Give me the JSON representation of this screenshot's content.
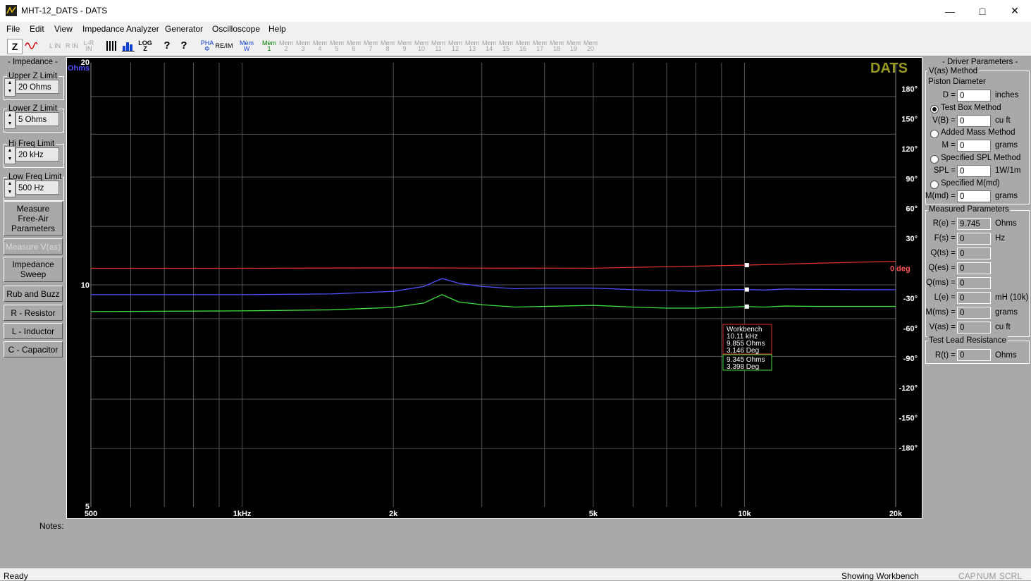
{
  "window": {
    "title": "MHT-12_DATS - DATS"
  },
  "menu": [
    "File",
    "Edit",
    "View",
    "Impedance Analyzer",
    "Generator",
    "Oscilloscope",
    "Help"
  ],
  "toolbar": {
    "buttons": [
      "Z",
      "~",
      "L IN",
      "R IN",
      "L-R IN",
      "",
      "",
      "LOG Z",
      "?",
      "?",
      "PHA Φ",
      "RE/IM",
      "Mem W"
    ],
    "mem_slots": [
      "1",
      "2",
      "3",
      "4",
      "5",
      "6",
      "7",
      "8",
      "9",
      "10",
      "11",
      "12",
      "13",
      "14",
      "15",
      "16",
      "17",
      "18",
      "19",
      "20"
    ]
  },
  "left": {
    "group_title": "- Impedance -",
    "upper_label": "Upper Z Limit",
    "upper_value": "20 Ohms",
    "lower_label": "Lower Z Limit",
    "lower_value": "5 Ohms",
    "hifreq_label": "Hi Freq Limit",
    "hifreq_value": "20 kHz",
    "lowfreq_label": "Low Freq Limit",
    "lowfreq_value": "500 Hz",
    "measure_free_air": [
      "Measure",
      "Free-Air",
      "Parameters"
    ],
    "measure_vas": "Measure V(as)",
    "impedance_sweep": [
      "Impedance",
      "Sweep"
    ],
    "rub_buzz": "Rub and Buzz",
    "r_resistor": "R - Resistor",
    "l_inductor": "L - Inductor",
    "c_capacitor": "C - Capacitor"
  },
  "plot": {
    "logo": "DATS",
    "y_unit": "Ohms",
    "y_ticks": [
      "20",
      "10",
      "5"
    ],
    "x_ticks": [
      "500",
      "1kHz",
      "2k",
      "5k",
      "10k",
      "20k"
    ],
    "phase_ticks": [
      "180°",
      "150°",
      "120°",
      "90°",
      "60°",
      "30°",
      "0 deg",
      "-30°",
      "-60°",
      "-90°",
      "-120°",
      "-150°",
      "-180°"
    ],
    "cursor_box1": [
      "Workbench",
      "10.11 kHz",
      "9.855 Ohms",
      "3.146 Deg"
    ],
    "cursor_box2": [
      "9.345 Ohms",
      "3.398 Deg"
    ],
    "colors": {
      "blue": "#5050ff",
      "green": "#40e040",
      "red": "#e03030",
      "logo": "#9a9a20",
      "grid": "#555555"
    }
  },
  "chart_data": {
    "type": "line",
    "title": "",
    "xlabel": "",
    "ylabel": "Ohms",
    "x_scale": "log",
    "y_scale": "log",
    "xlim": [
      500,
      20000
    ],
    "ylim": [
      5,
      20
    ],
    "y2lim": [
      -180,
      180
    ],
    "series": [
      {
        "x": [
          500,
          1000,
          1500,
          2000,
          2300,
          2500,
          2700,
          3000,
          3500,
          4000,
          5000,
          6000,
          7000,
          8000,
          9000,
          10000,
          11000,
          12000,
          14000,
          17000,
          20000
        ],
        "values": [
          9.7,
          9.7,
          9.72,
          9.8,
          9.95,
          10.2,
          10.05,
          9.95,
          9.88,
          9.9,
          9.9,
          9.85,
          9.82,
          9.8,
          9.85,
          9.855,
          9.84,
          9.87,
          9.86,
          9.85,
          9.85
        ]
      },
      {
        "x": [
          500,
          1000,
          1500,
          2000,
          2300,
          2500,
          2700,
          3000,
          3500,
          4000,
          5000,
          6000,
          7000,
          8000,
          9000,
          10000,
          11000,
          12000,
          14000,
          17000,
          20000
        ],
        "values": [
          9.2,
          9.22,
          9.25,
          9.32,
          9.45,
          9.7,
          9.48,
          9.4,
          9.33,
          9.35,
          9.38,
          9.33,
          9.3,
          9.3,
          9.32,
          9.345,
          9.33,
          9.36,
          9.35,
          9.35,
          9.35
        ]
      },
      {
        "x": [
          500,
          1000,
          2000,
          3000,
          5000,
          10000,
          15000,
          20000
        ],
        "values": [
          0,
          0,
          0.4,
          0.2,
          0.1,
          3.15,
          5.5,
          7.0
        ]
      }
    ]
  },
  "right": {
    "driver_title": "- Driver Parameters -",
    "vas_method": "V(as) Method",
    "piston_diameter": "Piston Diameter",
    "d_label": "D =",
    "d_value": "0",
    "d_unit": "inches",
    "test_box": "Test Box Method",
    "vb_label": "V(B) =",
    "vb_value": "0",
    "vb_unit": "cu ft",
    "added_mass": "Added Mass Method",
    "m_label": "M =",
    "m_value": "0",
    "m_unit": "grams",
    "spl_method": "Specified SPL Method",
    "spl_label": "SPL =",
    "spl_value": "0",
    "spl_unit": "1W/1m",
    "mmd_method": "Specified M(md)",
    "mmd_label": "M(md) =",
    "mmd_value": "0",
    "mmd_unit": "grams",
    "measured_title": "Measured Parameters",
    "params": [
      {
        "label": "R(e) =",
        "value": "9.745",
        "unit": "Ohms"
      },
      {
        "label": "F(s) =",
        "value": "0",
        "unit": "Hz"
      },
      {
        "label": "Q(ts) =",
        "value": "0",
        "unit": ""
      },
      {
        "label": "Q(es) =",
        "value": "0",
        "unit": ""
      },
      {
        "label": "Q(ms) =",
        "value": "0",
        "unit": ""
      },
      {
        "label": "L(e) =",
        "value": "0",
        "unit": "mH (10k)"
      },
      {
        "label": "M(ms) =",
        "value": "0",
        "unit": "grams"
      },
      {
        "label": "V(as) =",
        "value": "0",
        "unit": "cu ft"
      }
    ],
    "lead_title": "Test Lead Resistance",
    "rt_label": "R(t) =",
    "rt_value": "0",
    "rt_unit": "Ohms"
  },
  "notes_label": "Notes:",
  "status": {
    "left": "Ready",
    "middle": "Showing Workbench",
    "cap": "CAP",
    "num": "NUM",
    "scrl": "SCRL"
  }
}
